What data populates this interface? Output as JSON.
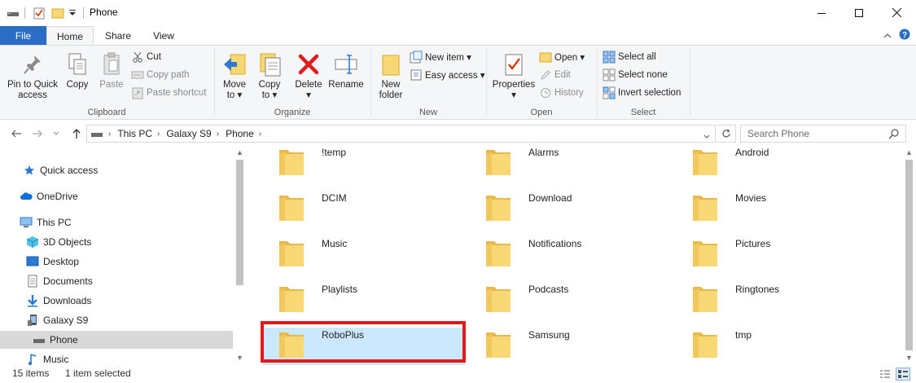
{
  "window": {
    "title": "Phone",
    "controls": [
      "minimize",
      "maximize",
      "close"
    ]
  },
  "tabs": {
    "file": "File",
    "items": [
      "Home",
      "Share",
      "View"
    ],
    "active": "Home"
  },
  "ribbon": {
    "clipboard": {
      "label": "Clipboard",
      "pin": "Pin to Quick access",
      "pin_line1": "Pin to Quick",
      "pin_line2": "access",
      "copy": "Copy",
      "paste": "Paste",
      "cut": "Cut",
      "copy_path": "Copy path",
      "paste_shortcut": "Paste shortcut"
    },
    "organize": {
      "label": "Organize",
      "move_to": "Move",
      "move_to_2": "to ▾",
      "copy_to": "Copy",
      "copy_to_2": "to ▾",
      "delete": "Delete",
      "delete_2": "▾",
      "rename": "Rename"
    },
    "new": {
      "label": "New",
      "new_folder": "New",
      "new_folder_2": "folder",
      "new_item": "New item ▾",
      "easy_access": "Easy access ▾"
    },
    "open": {
      "label": "Open",
      "properties": "Properties",
      "properties_2": "▾",
      "open": "Open ▾",
      "edit": "Edit",
      "history": "History"
    },
    "select": {
      "label": "Select",
      "select_all": "Select all",
      "select_none": "Select none",
      "invert_selection": "Invert selection"
    }
  },
  "address": {
    "breadcrumbs": [
      "This PC",
      "Galaxy S9",
      "Phone"
    ],
    "search_placeholder": "Search Phone"
  },
  "nav": {
    "items": [
      {
        "label": "Quick access",
        "icon": "star-icon"
      },
      {
        "label": "OneDrive",
        "icon": "cloud-icon"
      },
      {
        "label": "This PC",
        "icon": "pc-icon"
      },
      {
        "label": "3D Objects",
        "icon": "cube-icon"
      },
      {
        "label": "Desktop",
        "icon": "desktop-icon"
      },
      {
        "label": "Documents",
        "icon": "document-icon"
      },
      {
        "label": "Downloads",
        "icon": "download-icon"
      },
      {
        "label": "Galaxy S9",
        "icon": "phone-device-icon"
      },
      {
        "label": "Phone",
        "icon": "drive-icon"
      },
      {
        "label": "Music",
        "icon": "music-icon"
      }
    ],
    "selected": "Phone"
  },
  "folders": [
    "!temp",
    "Alarms",
    "Android",
    "DCIM",
    "Download",
    "Movies",
    "Music",
    "Notifications",
    "Pictures",
    "Playlists",
    "Podcasts",
    "Ringtones",
    "RoboPlus",
    "Samsung",
    "tmp"
  ],
  "selected_folder": "RoboPlus",
  "status": {
    "count": "15 items",
    "selection": "1 item selected"
  },
  "colors": {
    "file_tab": "#2b6cc4",
    "selection": "#cce8ff",
    "highlight": "#e01a1a",
    "folder": "#f8d775"
  }
}
